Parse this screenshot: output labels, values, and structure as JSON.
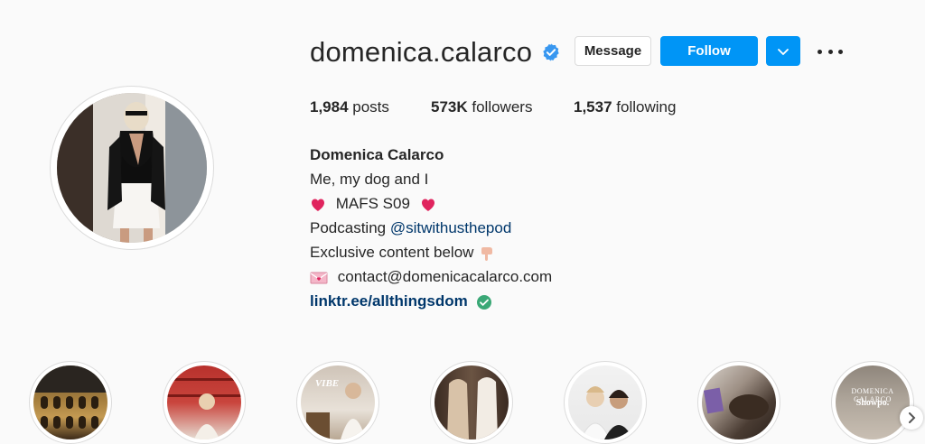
{
  "profile": {
    "username": "domenica.calarco",
    "verified_icon": "verified-badge-icon",
    "avatar_icon": "profile-photo"
  },
  "actions": {
    "message_label": "Message",
    "follow_label": "Follow",
    "dropdown_icon": "chevron-down-icon",
    "more_icon": "more-options-icon"
  },
  "stats": {
    "posts_count": "1,984",
    "posts_label": " posts",
    "followers_count": "573K",
    "followers_label": " followers",
    "following_count": "1,537",
    "following_label": " following"
  },
  "bio": {
    "name": "Domenica Calarco",
    "line1": "Me, my dog and I",
    "line2_text": "MAFS S09",
    "line3_prefix": "Podcasting ",
    "line3_mention": "@sitwithusthepod",
    "line4_text": "Exclusive content below",
    "line5_text": "contact@domenicacalarco.com",
    "link": "linktr.ee/allthingsdom"
  },
  "highlights": [
    {
      "name": "colosseum-highlight"
    },
    {
      "name": "shelves-highlight"
    },
    {
      "name": "vibe-highlight",
      "text": "VIBE"
    },
    {
      "name": "outfits-highlight"
    },
    {
      "name": "friends-highlight"
    },
    {
      "name": "dog-highlight"
    },
    {
      "name": "showpo-highlight",
      "text_top": "DOMENICA CALARCO",
      "text_bottom": "Showpo."
    }
  ],
  "colors": {
    "accent": "#0095f6",
    "link": "#00376b",
    "verified": "#3897f0",
    "heart": "#e0245e",
    "link_check": "#3aa876"
  }
}
